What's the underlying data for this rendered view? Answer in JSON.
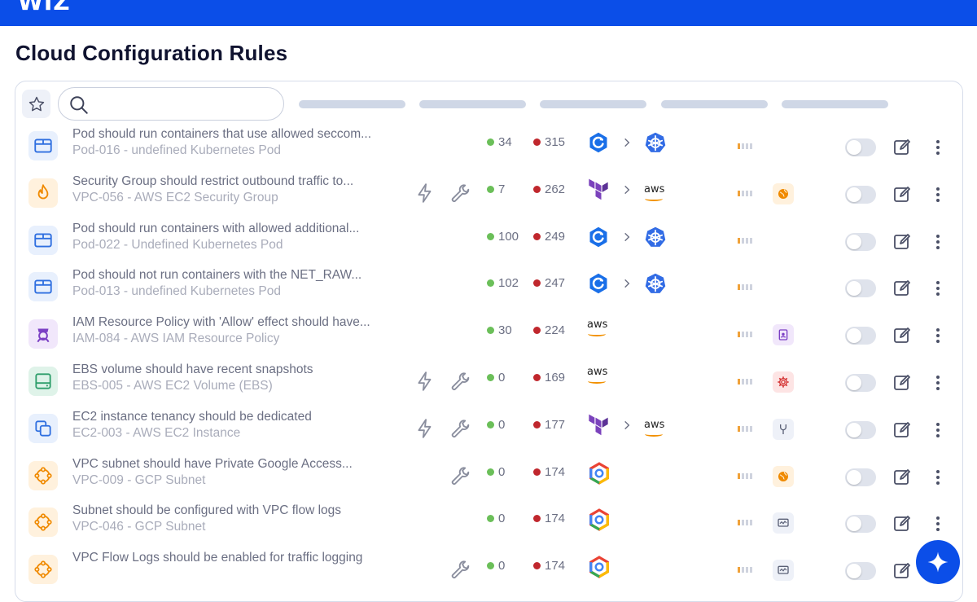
{
  "app": {
    "logo": "WIZ"
  },
  "page": {
    "title": "Cloud Configuration Rules"
  },
  "search": {
    "placeholder": ""
  },
  "colors": {
    "brand": "#0b4ee8",
    "pass_dot": "#6bbf59",
    "fail_dot": "#c0272d",
    "severity": "#f0a23a"
  },
  "rows": [
    {
      "icon": "kubernetes-pod-icon",
      "title": "Pod should run containers that use allowed seccom...",
      "subtitle": "Pod-016 - undefined Kubernetes Pod",
      "actions": [],
      "pass": "34",
      "fail": "315",
      "providers": [
        "admission-controller-icon",
        "kubernetes-icon"
      ],
      "severity": 1,
      "tag": null
    },
    {
      "icon": "security-group-icon",
      "title": "Security Group should restrict outbound traffic to...",
      "subtitle": "VPC-056 - AWS EC2 Security Group",
      "actions": [
        "bolt-icon",
        "wrench-icon"
      ],
      "pass": "7",
      "fail": "262",
      "providers": [
        "terraform-icon",
        "aws-icon"
      ],
      "severity": 1,
      "tag": "globe-icon"
    },
    {
      "icon": "kubernetes-pod-icon",
      "title": "Pod should run containers with allowed additional...",
      "subtitle": "Pod-022 - Undefined Kubernetes Pod",
      "actions": [],
      "pass": "100",
      "fail": "249",
      "providers": [
        "admission-controller-icon",
        "kubernetes-icon"
      ],
      "severity": 1,
      "tag": null
    },
    {
      "icon": "kubernetes-pod-icon",
      "title": "Pod should not run containers with the NET_RAW...",
      "subtitle": "Pod-013 - undefined Kubernetes Pod",
      "actions": [],
      "pass": "102",
      "fail": "247",
      "providers": [
        "admission-controller-icon",
        "kubernetes-icon"
      ],
      "severity": 1,
      "tag": null
    },
    {
      "icon": "iam-policy-icon",
      "title": "IAM Resource Policy with 'Allow' effect should have...",
      "subtitle": "IAM-084 - AWS IAM Resource Policy",
      "actions": [],
      "pass": "30",
      "fail": "224",
      "providers": [
        "aws-icon"
      ],
      "severity": 1,
      "tag": "id-badge-icon"
    },
    {
      "icon": "ebs-volume-icon",
      "title": "EBS volume should have recent snapshots",
      "subtitle": "EBS-005 - AWS EC2 Volume (EBS)",
      "actions": [
        "bolt-icon",
        "wrench-icon"
      ],
      "pass": "0",
      "fail": "169",
      "providers": [
        "aws-icon"
      ],
      "severity": 1,
      "tag": "gear-icon"
    },
    {
      "icon": "ec2-instance-icon",
      "title": "EC2 instance tenancy should be dedicated",
      "subtitle": "EC2-003 - AWS EC2 Instance",
      "actions": [
        "bolt-icon",
        "wrench-icon"
      ],
      "pass": "0",
      "fail": "177",
      "providers": [
        "terraform-icon",
        "aws-icon"
      ],
      "severity": 1,
      "tag": "tool-icon"
    },
    {
      "icon": "gcp-subnet-icon",
      "title": "VPC subnet should have Private Google Access...",
      "subtitle": "VPC-009 - GCP Subnet",
      "actions": [
        "wrench-icon"
      ],
      "pass": "0",
      "fail": "174",
      "providers": [
        "gcp-icon"
      ],
      "severity": 1,
      "tag": "globe-icon"
    },
    {
      "icon": "gcp-subnet-icon",
      "title": "Subnet should be configured with VPC flow logs",
      "subtitle": "VPC-046 - GCP Subnet",
      "actions": [],
      "pass": "0",
      "fail": "174",
      "providers": [
        "gcp-icon"
      ],
      "severity": 1,
      "tag": "monitor-icon"
    },
    {
      "icon": "gcp-subnet-icon",
      "title": "VPC Flow Logs should be enabled for traffic logging",
      "subtitle": "",
      "actions": [
        "wrench-icon"
      ],
      "pass": "0",
      "fail": "174",
      "providers": [
        "gcp-icon"
      ],
      "severity": 1,
      "tag": "monitor-icon"
    }
  ]
}
